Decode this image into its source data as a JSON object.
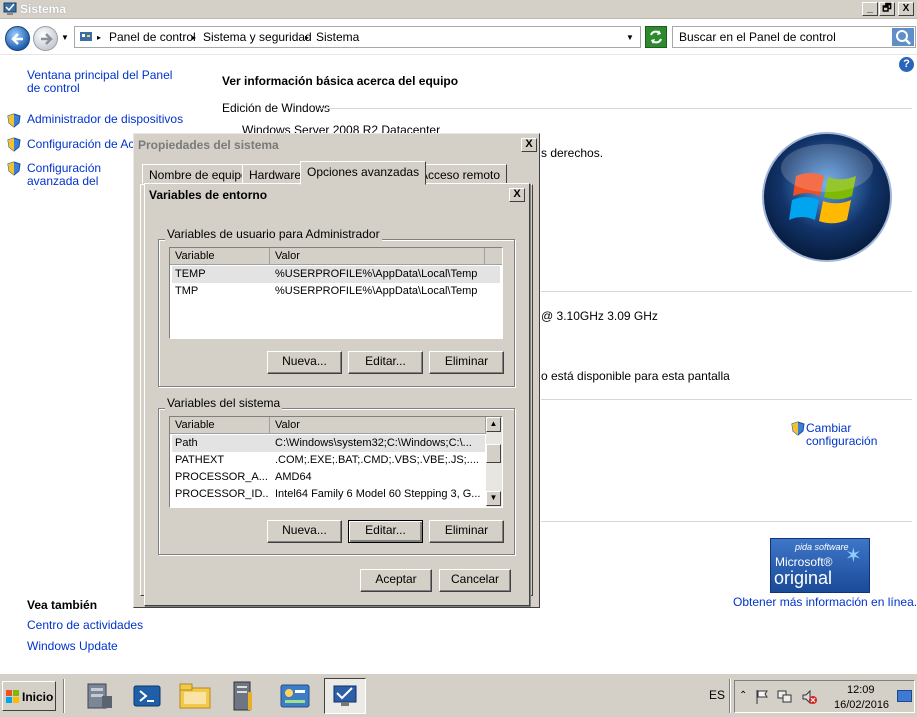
{
  "window": {
    "title": "Sistema",
    "minimize": "_",
    "restore": "🗗",
    "close": "X"
  },
  "address": {
    "crumbs": [
      "Panel de control",
      "Sistema y seguridad",
      "Sistema"
    ],
    "search_placeholder": "Buscar en el Panel de control"
  },
  "left_pane": {
    "home_link": "Ventana principal del Panel de control",
    "links": [
      "Administrador de dispositivos",
      "Configuración de Acceso remoto",
      "Configuración avanzada del sistema"
    ],
    "see_also_title": "Vea también",
    "see_also": [
      "Centro de actividades",
      "Windows Update"
    ]
  },
  "content": {
    "heading": "Ver información básica acerca del equipo",
    "edition_section": "Edición de Windows",
    "edition": "Windows Server 2008 R2 Datacenter",
    "rights_fragment": "s derechos.",
    "cpu_fragment": "@ 3.10GHz   3.09 GHz",
    "display_fragment": "o está disponible para esta pantalla",
    "change_settings": "Cambiar configuración",
    "genuine_line1": "pida software",
    "genuine_line2": "Microsoft®",
    "genuine_line3": "original",
    "more_info": "Obtener más información en línea..."
  },
  "props_dialog": {
    "title": "Propiedades del sistema",
    "close": "X",
    "tabs": [
      "Nombre de equipo",
      "Hardware",
      "Opciones avanzadas",
      "Acceso remoto"
    ],
    "active_tab": 2
  },
  "env_dialog": {
    "title": "Variables de entorno",
    "close": "X",
    "user_group": "Variables de usuario para Administrador",
    "columns": [
      "Variable",
      "Valor"
    ],
    "user_vars": [
      {
        "name": "TEMP",
        "value": "%USERPROFILE%\\AppData\\Local\\Temp"
      },
      {
        "name": "TMP",
        "value": "%USERPROFILE%\\AppData\\Local\\Temp"
      }
    ],
    "system_group": "Variables del sistema",
    "system_vars": [
      {
        "name": "Path",
        "value": "C:\\Windows\\system32;C:\\Windows;C:\\..."
      },
      {
        "name": "PATHEXT",
        "value": ".COM;.EXE;.BAT;.CMD;.VBS;.VBE;.JS;...."
      },
      {
        "name": "PROCESSOR_A...",
        "value": "AMD64"
      },
      {
        "name": "PROCESSOR_ID...",
        "value": "Intel64 Family 6 Model 60 Stepping 3, G..."
      }
    ],
    "new_label": "Nueva...",
    "edit_label": "Editar...",
    "delete_label": "Eliminar",
    "ok_label": "Aceptar",
    "cancel_label": "Cancelar"
  },
  "taskbar": {
    "start_label": "Inicio",
    "lang": "ES",
    "time": "12:09",
    "date": "16/02/2016"
  }
}
